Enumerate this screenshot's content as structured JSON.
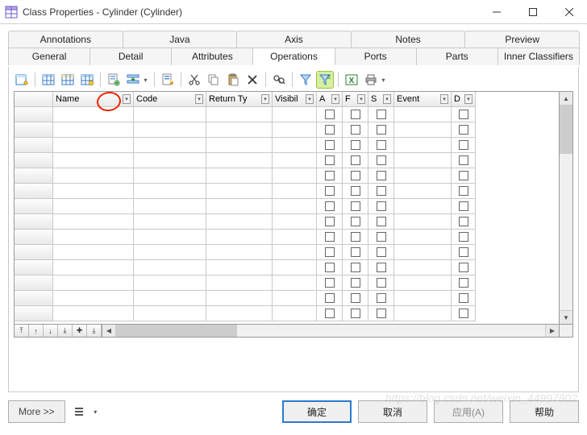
{
  "window": {
    "title": "Class Properties - Cylinder (Cylinder)"
  },
  "tabs_row1": [
    {
      "label": "Annotations"
    },
    {
      "label": "Java"
    },
    {
      "label": "Axis"
    },
    {
      "label": "Notes"
    },
    {
      "label": "Preview"
    }
  ],
  "tabs_row2": [
    {
      "label": "General"
    },
    {
      "label": "Detail"
    },
    {
      "label": "Attributes"
    },
    {
      "label": "Operations"
    },
    {
      "label": "Ports"
    },
    {
      "label": "Parts"
    },
    {
      "label": "Inner Classifiers"
    }
  ],
  "active_tab": "Operations",
  "grid": {
    "columns": [
      {
        "label": ""
      },
      {
        "label": "Name"
      },
      {
        "label": "Code"
      },
      {
        "label": "Return Ty"
      },
      {
        "label": "Visibil"
      },
      {
        "label": "A"
      },
      {
        "label": "F"
      },
      {
        "label": "S"
      },
      {
        "label": "Event"
      },
      {
        "label": "D"
      }
    ],
    "checkbox_cols": [
      5,
      6,
      7,
      9
    ],
    "row_count": 14
  },
  "nav_buttons": [
    "⤒",
    "↑",
    "↓",
    "⤓",
    "✚",
    "⤓"
  ],
  "footer": {
    "more": "More >>",
    "ok": "确定",
    "cancel": "取消",
    "apply": "应用(A)",
    "help": "帮助"
  },
  "watermark": "https://blog.csdn.net/weixin_44997802"
}
